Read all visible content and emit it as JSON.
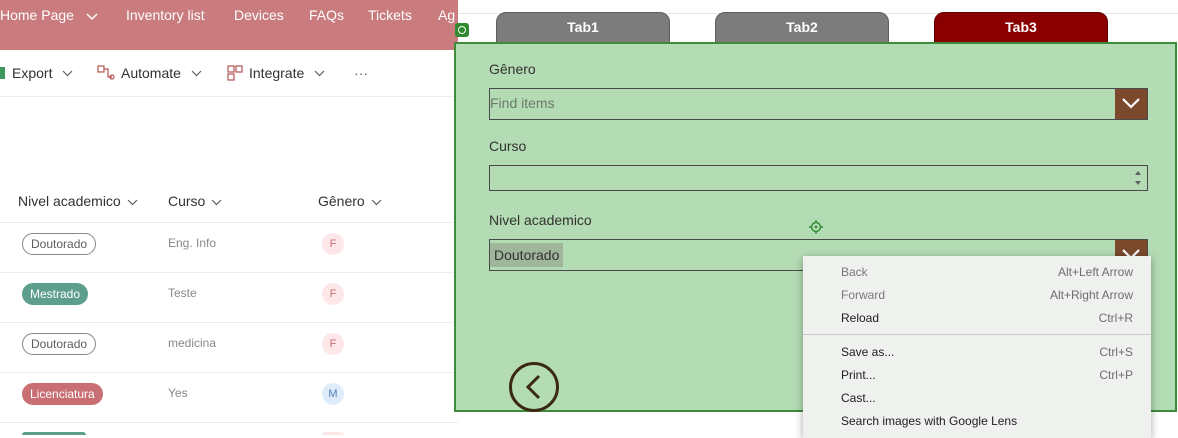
{
  "topnav": {
    "items": [
      "Home Page",
      "Inventory list",
      "Devices",
      "FAQs",
      "Tickets",
      "Ag"
    ]
  },
  "commandbar": {
    "export": "Export",
    "automate": "Automate",
    "integrate": "Integrate",
    "more": "···"
  },
  "list": {
    "headers": [
      "Nivel academico",
      "Curso",
      "Gênero"
    ],
    "rows": [
      {
        "nivel": "Doutorado",
        "curso": "Eng. Info",
        "genero": "F"
      },
      {
        "nivel": "Mestrado",
        "curso": "Teste",
        "genero": "F"
      },
      {
        "nivel": "Doutorado",
        "curso": "medicina",
        "genero": "F"
      },
      {
        "nivel": "Licenciatura",
        "curso": "Yes",
        "genero": "M"
      }
    ]
  },
  "tabs": [
    "Tab1",
    "Tab2",
    "Tab3"
  ],
  "form": {
    "genero_label": "Gênero",
    "genero_placeholder": "Find items",
    "curso_label": "Curso",
    "curso_value": "",
    "nivel_label": "Nivel academico",
    "nivel_value": "Doutorado"
  },
  "context_menu": {
    "items": [
      {
        "label": "Back",
        "shortcut": "Alt+Left Arrow"
      },
      {
        "label": "Forward",
        "shortcut": "Alt+Right Arrow"
      },
      {
        "label": "Reload",
        "shortcut": "Ctrl+R"
      },
      {
        "label": "Save as...",
        "shortcut": "Ctrl+S"
      },
      {
        "label": "Print...",
        "shortcut": "Ctrl+P"
      },
      {
        "label": "Cast...",
        "shortcut": ""
      },
      {
        "label": "Search images with Google Lens",
        "shortcut": ""
      }
    ]
  },
  "colors": {
    "nav_bg": "#c97b7e",
    "mestrado_pill": "#5e9e8c",
    "licenciatura_pill": "#c96f74",
    "tab_active": "#8a0000",
    "tab_inactive": "#7c7c7c",
    "form_bg": "#b4dcb4",
    "dropdown_button": "#7b4a2d"
  }
}
